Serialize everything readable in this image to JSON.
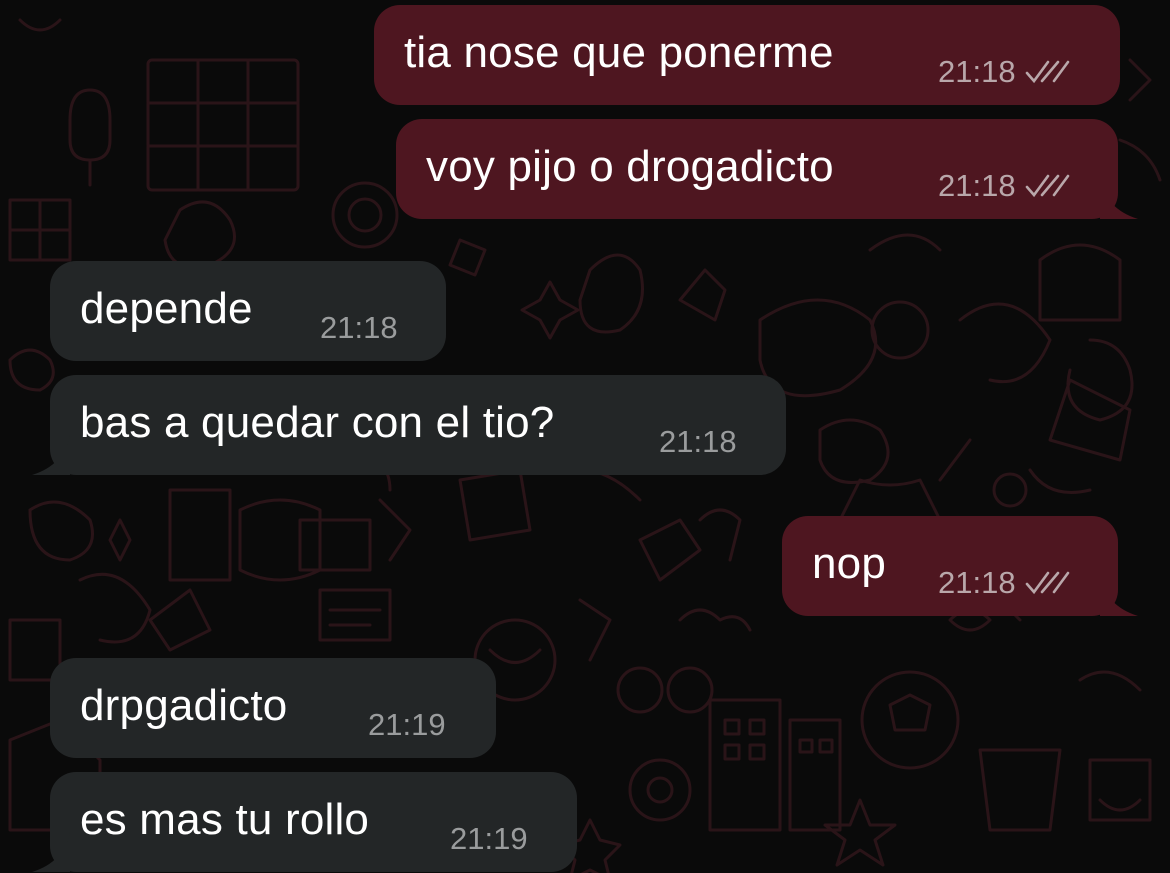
{
  "colors": {
    "outgoing_bubble": "#4e1620",
    "incoming_bubble": "#232627",
    "background": "#0a0a0a",
    "text": "#ffffff",
    "time_outgoing": "#b9a7aa",
    "time_incoming": "#9a9c9d"
  },
  "messages": [
    {
      "direction": "outgoing",
      "text": "tia nose que ponerme",
      "time": "21:18",
      "status_icon": "double-check-icon"
    },
    {
      "direction": "outgoing",
      "text": "voy pijo o drogadicto",
      "time": "21:18",
      "status_icon": "double-check-icon"
    },
    {
      "direction": "incoming",
      "text": "depende",
      "time": "21:18"
    },
    {
      "direction": "incoming",
      "text": "bas a quedar con el tio?",
      "time": "21:18"
    },
    {
      "direction": "outgoing",
      "text": "nop",
      "time": "21:18",
      "status_icon": "double-check-icon"
    },
    {
      "direction": "incoming",
      "text": "drpgadicto",
      "time": "21:19"
    },
    {
      "direction": "incoming",
      "text": "es mas tu rollo",
      "time": "21:19"
    }
  ]
}
